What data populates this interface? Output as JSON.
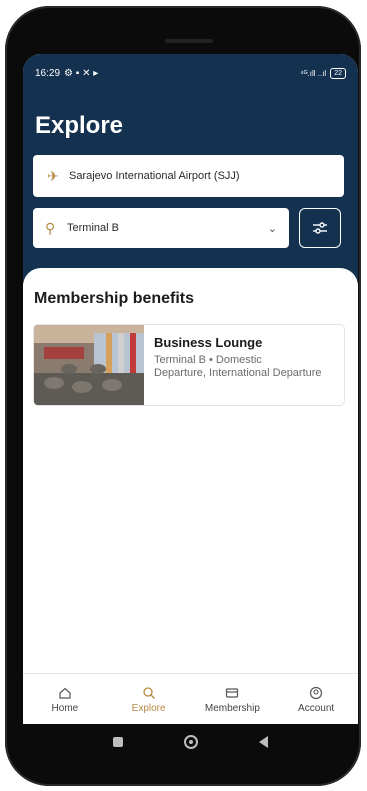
{
  "status": {
    "time": "16:29",
    "left_icons": "⚙ ▪ ✕ ▸",
    "right_icons": "⁴ᴳ.ıll ..ıl",
    "battery": "22"
  },
  "header": {
    "title": "Explore"
  },
  "search": {
    "value": "Sarajevo International Airport (SJJ)"
  },
  "terminal": {
    "value": "Terminal B"
  },
  "section": {
    "title": "Membership benefits"
  },
  "card": {
    "name": "Business Lounge",
    "line1": "Terminal B • Domestic",
    "line2": "Departure, International Departure"
  },
  "tabs": [
    {
      "label": "Home",
      "icon": "home-icon"
    },
    {
      "label": "Explore",
      "icon": "search-icon"
    },
    {
      "label": "Membership",
      "icon": "card-icon"
    },
    {
      "label": "Account",
      "icon": "account-icon"
    }
  ],
  "colors": {
    "header": "#143150",
    "accent": "#b38a45"
  }
}
